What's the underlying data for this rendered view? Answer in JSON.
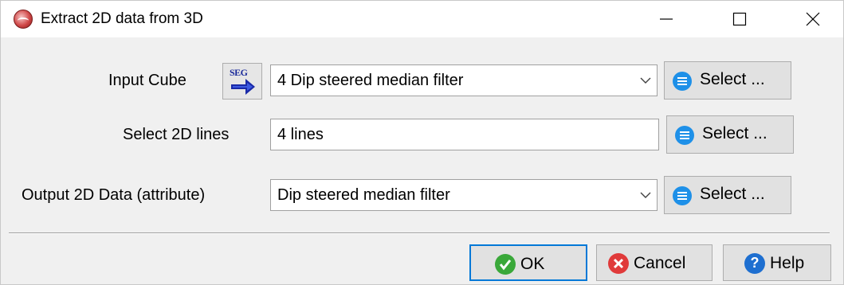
{
  "window": {
    "title": "Extract 2D data from 3D",
    "icon": "app-icon"
  },
  "controls": {
    "minimize_icon": "minimize-icon",
    "maximize_icon": "maximize-icon",
    "close_icon": "close-icon"
  },
  "input_cube": {
    "label": "Input Cube",
    "seg_button_text": "SEG",
    "value": "4 Dip steered median filter",
    "select_label": "Select ..."
  },
  "select_2d_lines": {
    "label": "Select 2D lines",
    "value": "4 lines",
    "select_label": "Select ..."
  },
  "output_2d": {
    "label": "Output 2D Data (attribute)",
    "value": "Dip steered median filter",
    "select_label": "Select ..."
  },
  "buttons": {
    "ok": "OK",
    "cancel": "Cancel",
    "help": "Help"
  },
  "colors": {
    "accent": "#0078d7",
    "ok_green": "#3aa83a",
    "cancel_red": "#e03a3a",
    "help_blue": "#1e6fd0",
    "select_blue": "#1e90e8"
  }
}
